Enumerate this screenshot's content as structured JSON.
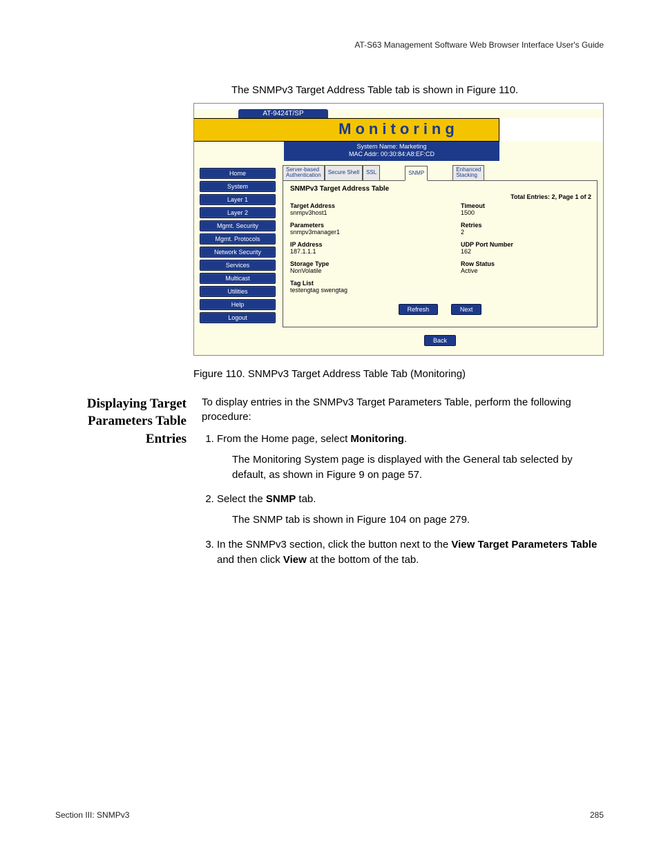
{
  "doc_header": "AT-S63 Management Software Web Browser Interface User's Guide",
  "intro": "The SNMPv3 Target Address Table tab is shown in Figure 110.",
  "screenshot": {
    "device": "AT-9424T/SP",
    "banner": "Monitoring",
    "sys_name": "System Name: Marketing",
    "mac": "MAC Addr: 00:30:84:A8:EF:CD",
    "nav": [
      "Home",
      "System",
      "Layer 1",
      "Layer 2",
      "Mgmt. Security",
      "Mgmt. Protocols",
      "Network Security",
      "Services",
      "Multicast",
      "Utilities",
      "Help",
      "Logout"
    ],
    "tabs": {
      "t1": "Server-based\nAuthentication",
      "t2": "Secure Shell",
      "t3": "SSL",
      "t4": "SNMP",
      "t5": "Enhanced\nStacking"
    },
    "panel_title": "SNMPv3 Target Address Table",
    "entries_info": "Total Entries: 2, Page 1 of 2",
    "left": {
      "target_address_l": "Target Address",
      "target_address_v": "snmpv3host1",
      "parameters_l": "Parameters",
      "parameters_v": "snmpv3manager1",
      "ip_l": "IP Address",
      "ip_v": "187.1.1.1",
      "storage_l": "Storage Type",
      "storage_v": "NonVolatile",
      "tag_l": "Tag List",
      "tag_v": "testengtag swengtag"
    },
    "right": {
      "timeout_l": "Timeout",
      "timeout_v": "1500",
      "retries_l": "Retries",
      "retries_v": "2",
      "udp_l": "UDP Port Number",
      "udp_v": "162",
      "row_l": "Row Status",
      "row_v": "Active"
    },
    "btn_refresh": "Refresh",
    "btn_next": "Next",
    "btn_back": "Back"
  },
  "figure_caption": "Figure 110. SNMPv3 Target Address Table Tab (Monitoring)",
  "side_heading": "Displaying Target Parameters Table Entries",
  "para_intro": "To display entries in the SNMPv3 Target Parameters Table, perform the following procedure:",
  "steps": {
    "s1a": "From the Home page, select ",
    "s1b": "Monitoring",
    "s1c": ".",
    "s1_sub": "The Monitoring System page is displayed with the General tab selected by default, as shown in Figure 9 on page 57.",
    "s2a": "Select the ",
    "s2b": "SNMP",
    "s2c": " tab.",
    "s2_sub": "The SNMP tab is shown in Figure 104 on page 279.",
    "s3a": "In the SNMPv3 section, click the button next to the ",
    "s3b": "View Target Parameters Table",
    "s3c": " and then click ",
    "s3d": "View",
    "s3e": " at the bottom of the tab."
  },
  "footer_left": "Section III: SNMPv3",
  "footer_right": "285"
}
